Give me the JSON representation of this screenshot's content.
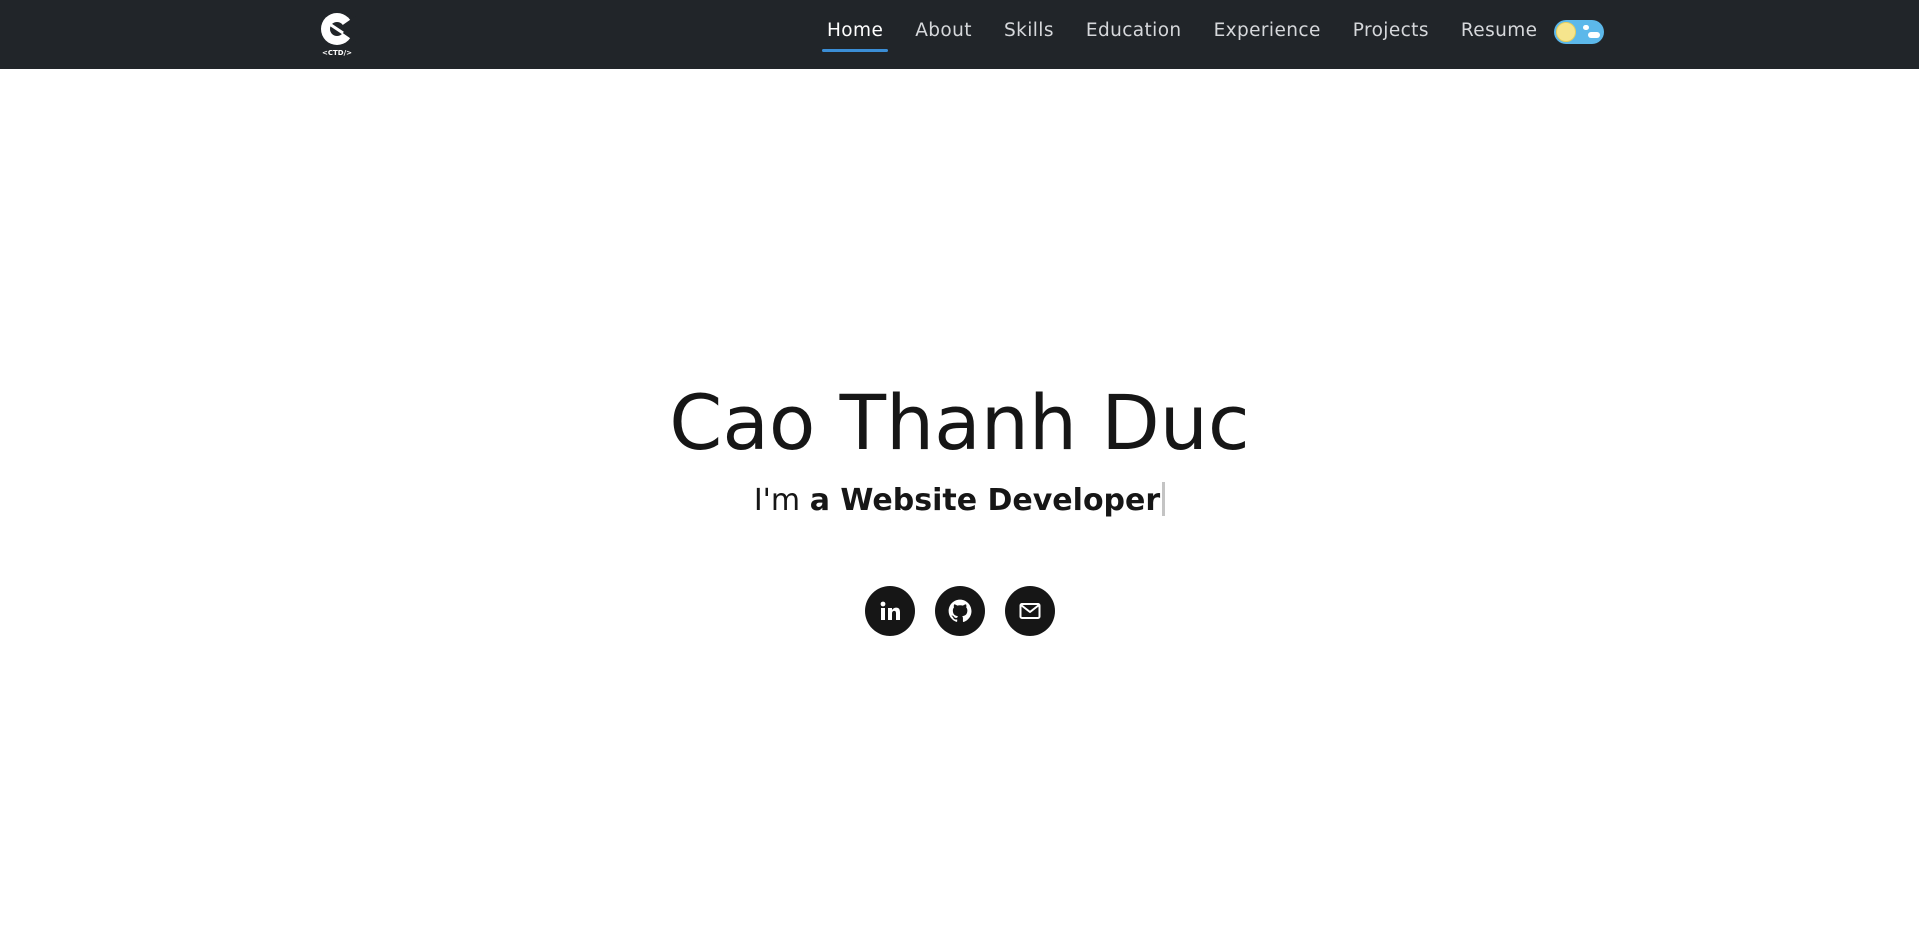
{
  "navbar": {
    "logo_text": "<CTD/>",
    "items": [
      {
        "label": "Home",
        "active": true
      },
      {
        "label": "About",
        "active": false
      },
      {
        "label": "Skills",
        "active": false
      },
      {
        "label": "Education",
        "active": false
      },
      {
        "label": "Experience",
        "active": false
      },
      {
        "label": "Projects",
        "active": false
      },
      {
        "label": "Resume",
        "active": false
      }
    ],
    "theme_toggle": {
      "state": "light",
      "icons": [
        "sun-icon",
        "cloud-icon"
      ]
    }
  },
  "hero": {
    "name": "Cao Thanh Duc",
    "subtitle_prefix": "I'm ",
    "subtitle_article": "a ",
    "subtitle_role": "Website Developer"
  },
  "social": [
    {
      "name": "linkedin",
      "icon": "linkedin-icon"
    },
    {
      "name": "github",
      "icon": "github-icon"
    },
    {
      "name": "email",
      "icon": "mail-icon"
    }
  ],
  "colors": {
    "navbar_bg": "#212529",
    "accent": "#3b8ed6",
    "text_dark": "#161616",
    "toggle_bg": "#5cb8ea"
  }
}
